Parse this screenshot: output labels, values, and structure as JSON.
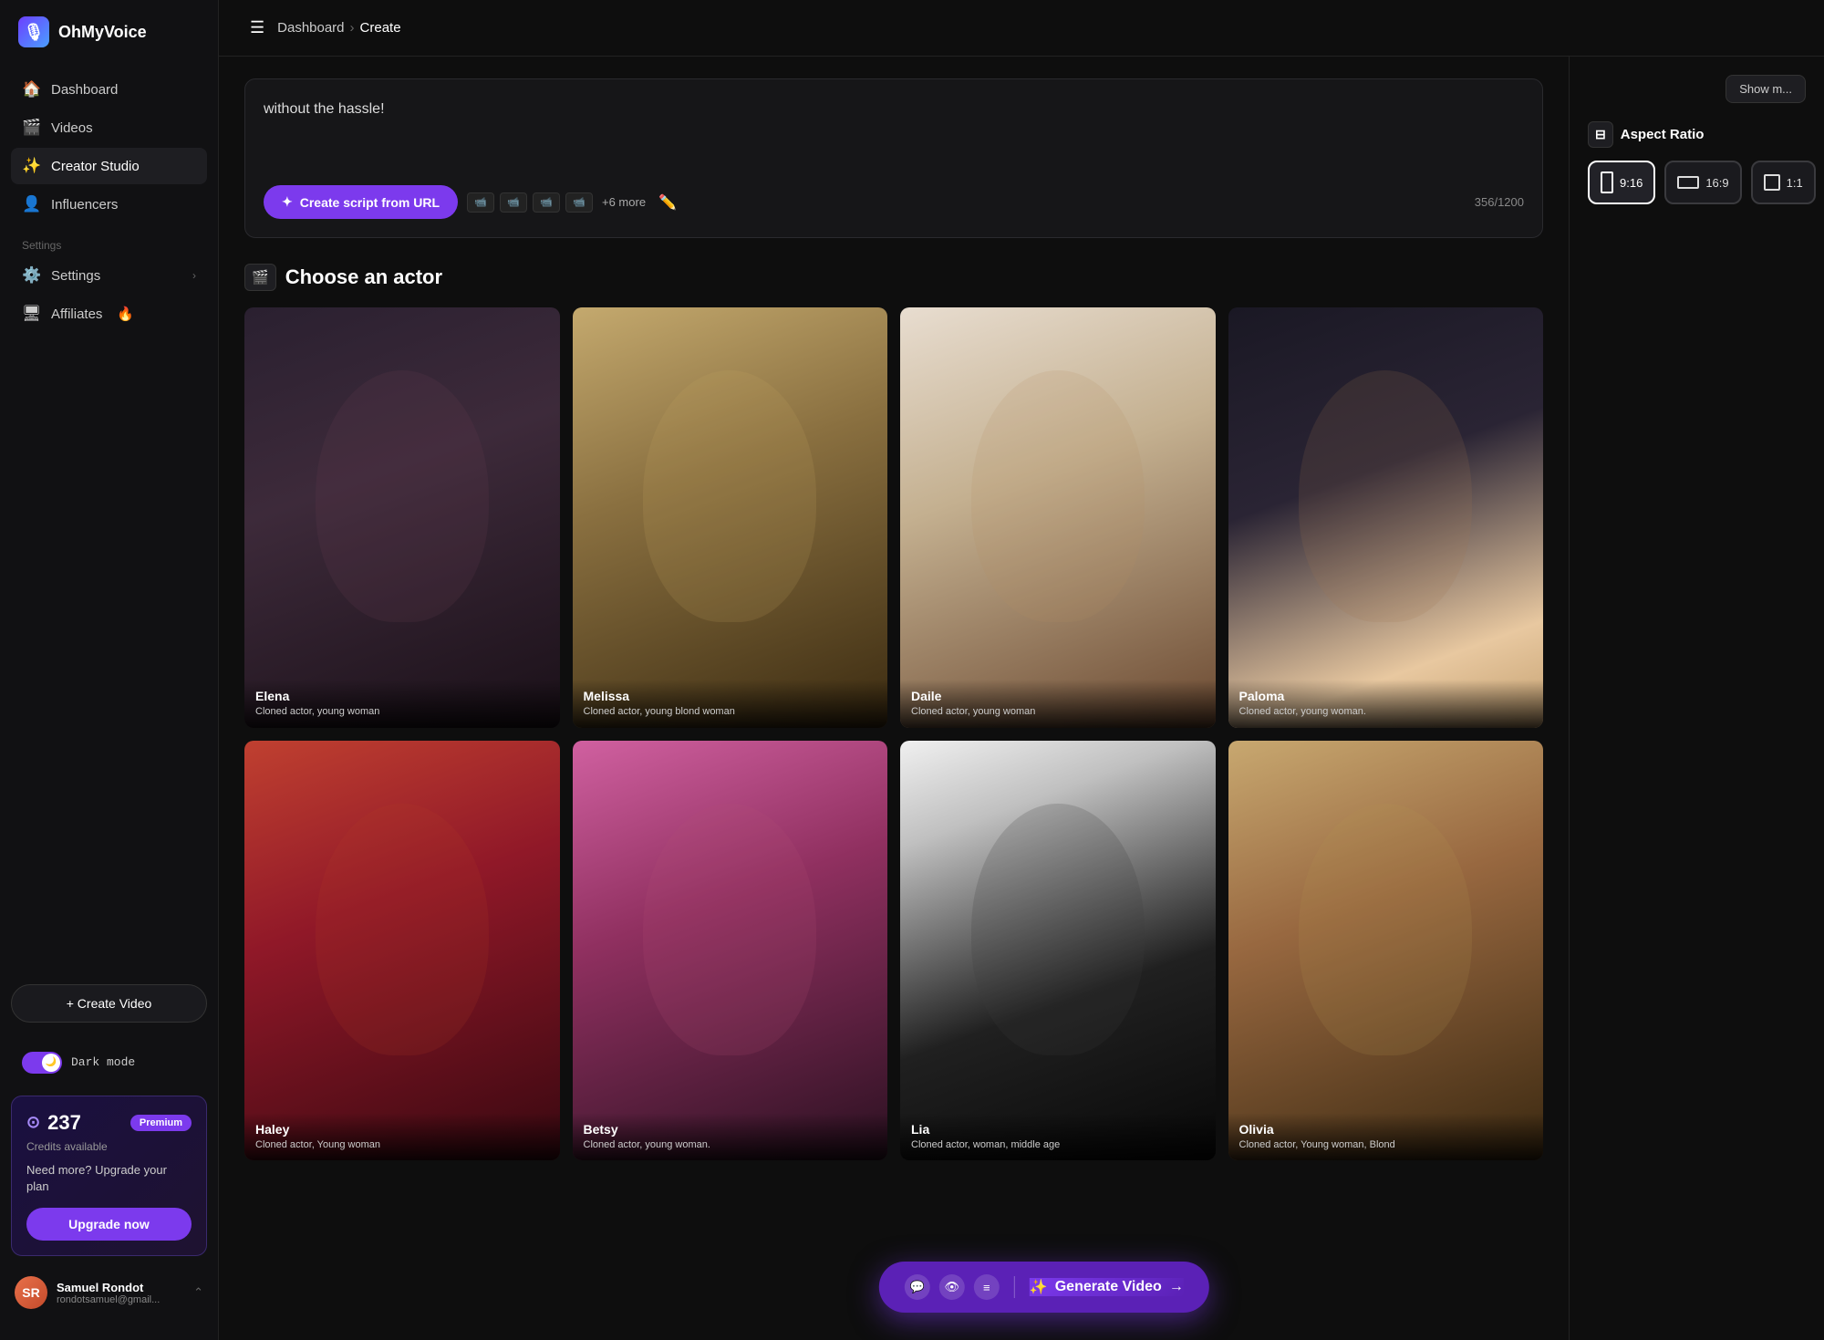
{
  "app": {
    "name": "OhMyVoice",
    "logo_emoji": "🎙"
  },
  "sidebar": {
    "nav_items": [
      {
        "id": "dashboard",
        "label": "Dashboard",
        "icon": "🏠",
        "active": false
      },
      {
        "id": "videos",
        "label": "Videos",
        "icon": "🎬",
        "active": false
      },
      {
        "id": "creator-studio",
        "label": "Creator Studio",
        "icon": "✨",
        "active": true
      }
    ],
    "influencers": {
      "label": "Influencers",
      "icon": "👤"
    },
    "settings_label": "Settings",
    "settings": {
      "label": "Settings",
      "icon": "⚙️"
    },
    "affiliates": {
      "label": "Affiliates",
      "icon": "🖥",
      "badge": "🔥"
    },
    "create_video_btn": "+ Create Video",
    "dark_mode_label": "Dark  mode",
    "credits": {
      "amount": "237",
      "badge": "Premium",
      "label": "Credits available",
      "description": "Need more? Upgrade your plan",
      "upgrade_btn": "Upgrade now"
    },
    "user": {
      "name": "Samuel Rondot",
      "email": "rondotsamuel@gmail..."
    }
  },
  "topbar": {
    "breadcrumb_home": "Dashboard",
    "breadcrumb_sep": "›",
    "breadcrumb_current": "Create"
  },
  "script": {
    "text": "without the hassle!",
    "create_btn": "Create script from URL",
    "more_label": "+6 more",
    "char_count": "356/1200"
  },
  "actor_section": {
    "title": "Choose an actor",
    "actors": [
      {
        "id": "elena",
        "name": "Elena",
        "desc": "Cloned actor, young woman",
        "color_class": "actor-elena"
      },
      {
        "id": "melissa",
        "name": "Melissa",
        "desc": "Cloned actor, young blond woman",
        "color_class": "actor-melissa"
      },
      {
        "id": "daile",
        "name": "Daile",
        "desc": "Cloned actor, young woman",
        "color_class": "actor-daile"
      },
      {
        "id": "paloma",
        "name": "Paloma",
        "desc": "Cloned actor, young woman.",
        "color_class": "actor-paloma"
      },
      {
        "id": "haley",
        "name": "Haley",
        "desc": "Cloned actor, Young woman",
        "color_class": "actor-haley"
      },
      {
        "id": "betsy",
        "name": "Betsy",
        "desc": "Cloned actor, young woman.",
        "color_class": "actor-betsy"
      },
      {
        "id": "lia",
        "name": "Lia",
        "desc": "Cloned actor, woman, middle age",
        "color_class": "actor-lia"
      },
      {
        "id": "olivia",
        "name": "Olivia",
        "desc": "Cloned actor, Young woman, Blond",
        "color_class": "actor-olivia"
      }
    ]
  },
  "right_panel": {
    "show_more": "Show m...",
    "aspect_ratio_label": "Aspect Ratio",
    "aspect_options": [
      {
        "id": "916",
        "label": "9:16",
        "active": true,
        "shape": "portrait"
      },
      {
        "id": "169",
        "label": "16:9",
        "active": false,
        "shape": "landscape"
      },
      {
        "id": "11",
        "label": "1:1",
        "active": false,
        "shape": "square"
      }
    ]
  },
  "generate_bar": {
    "icons": [
      "💬",
      "👁",
      "≡"
    ],
    "btn_label": "Generate Video",
    "btn_icon": "✨",
    "btn_arrow": "→"
  }
}
